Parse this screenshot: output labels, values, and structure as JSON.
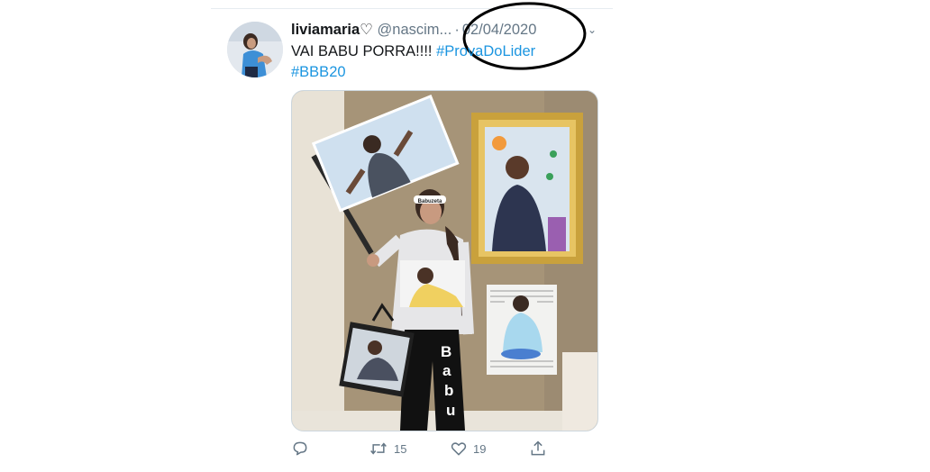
{
  "tweet": {
    "display_name": "liviamaria",
    "name_icon": "white-heart-icon",
    "handle": "@nascim...",
    "separator": "·",
    "date": "02/04/2020",
    "text_main": "VAI BABU PORRA!!!! ",
    "hashtags": [
      "#ProvaDoLider",
      "#BBB20"
    ],
    "image": {
      "headband_text": "Babuzeta",
      "leg_letters": [
        "B",
        "a",
        "b",
        "u"
      ]
    },
    "actions": {
      "reply_icon": "reply-icon",
      "retweet_icon": "retweet-icon",
      "retweet_count": "15",
      "like_icon": "heart-icon",
      "like_count": "19",
      "share_icon": "share-icon"
    }
  },
  "colors": {
    "link": "#1b95e0",
    "text": "#14171a",
    "muted": "#657786",
    "annotation_oval": "#000000"
  }
}
